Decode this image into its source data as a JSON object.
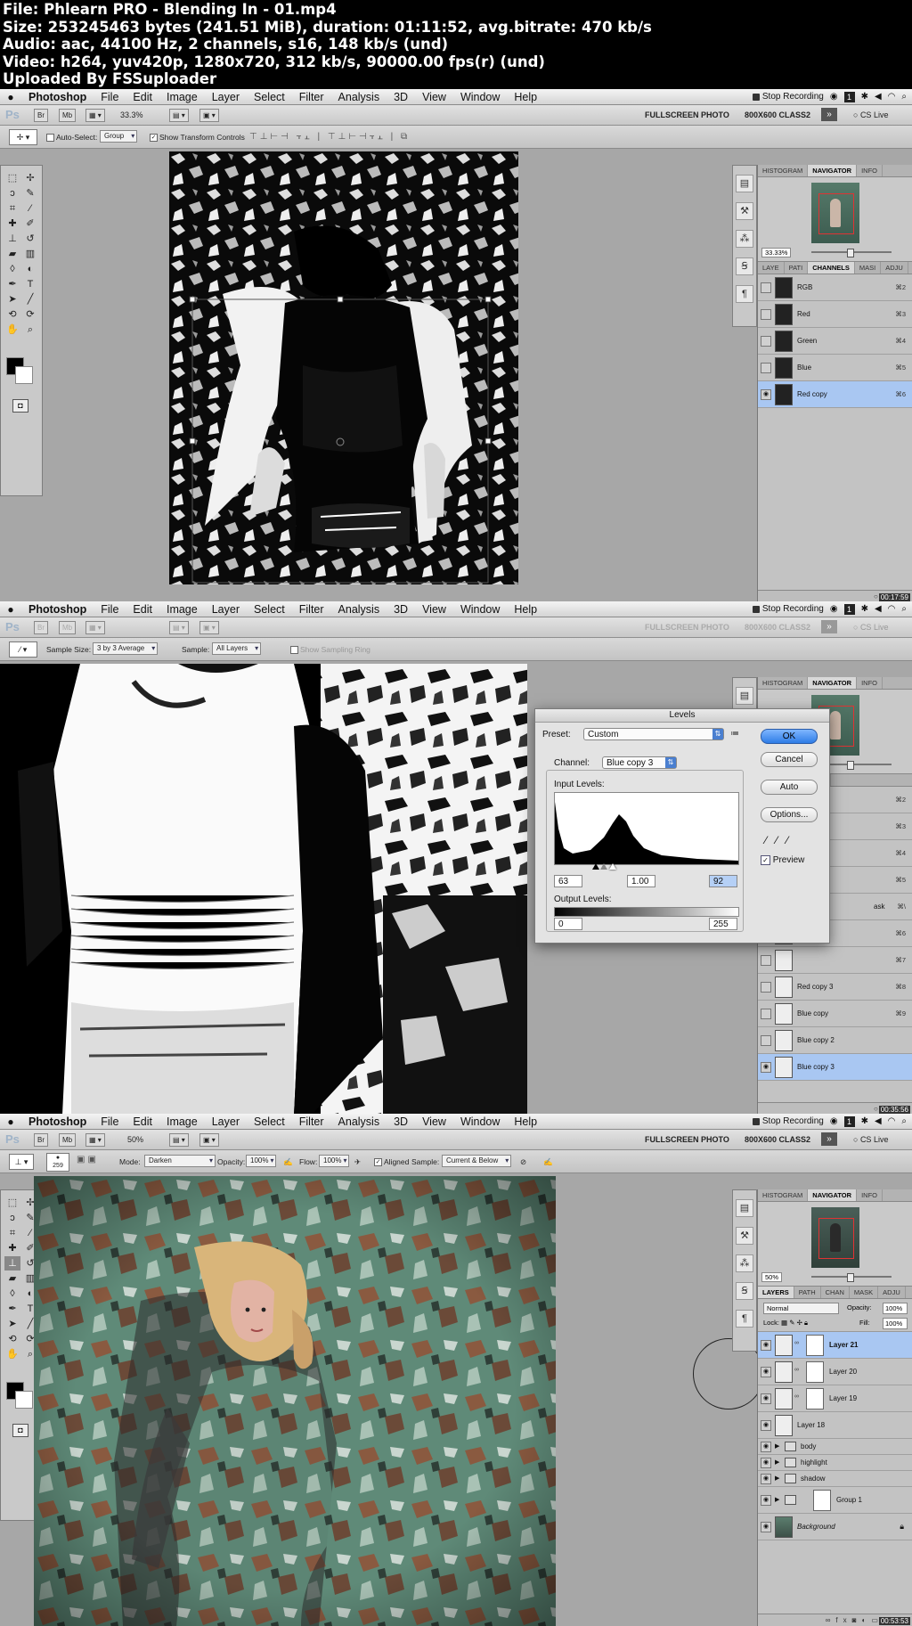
{
  "file_info": {
    "line1": "File: Phlearn PRO - Blending In - 01.mp4",
    "line2": "Size: 253245463 bytes (241.51 MiB), duration: 01:11:52, avg.bitrate: 470 kb/s",
    "line3": "Audio: aac, 44100 Hz, 2 channels, s16, 148 kb/s (und)",
    "line4": "Video: h264, yuv420p, 1280x720, 312 kb/s, 90000.00 fps(r) (und)",
    "line5": "Uploaded By FSSuploader"
  },
  "menu": {
    "app": "Photoshop",
    "items": [
      "File",
      "Edit",
      "Image",
      "Layer",
      "Select",
      "Filter",
      "Analysis",
      "3D",
      "View",
      "Window",
      "Help"
    ],
    "stop_recording": "Stop Recording",
    "badge": "1"
  },
  "appbar": {
    "ps": "Ps",
    "workspace1": "FULLSCREEN PHOTO",
    "workspace2": "800X600 CLASS2",
    "chevron": "»",
    "cs_live": "CS Live"
  },
  "frame1": {
    "zoom": "33.3%",
    "options": {
      "auto_select": "Auto-Select:",
      "group": "Group",
      "show_transform": "Show Transform Controls"
    },
    "panel_tabs_top": [
      "HISTOGRAM",
      "NAVIGATOR",
      "INFO"
    ],
    "nav_zoom": "33.33%",
    "panel_tabs_bottom": [
      "LAYE",
      "PATI",
      "CHANNELS",
      "MASI",
      "ADJU"
    ],
    "channels": [
      {
        "name": "RGB",
        "short": "⌘2"
      },
      {
        "name": "Red",
        "short": "⌘3"
      },
      {
        "name": "Green",
        "short": "⌘4"
      },
      {
        "name": "Blue",
        "short": "⌘5"
      },
      {
        "name": "Red copy",
        "short": "⌘6"
      }
    ],
    "timestamp": "00:17:59"
  },
  "frame2": {
    "options": {
      "sample_size_label": "Sample Size:",
      "sample_size": "3 by 3 Average",
      "sample_label": "Sample:",
      "sample": "All Layers",
      "ring": "Show Sampling Ring"
    },
    "channel_shortcuts": [
      "⌘2",
      "⌘3",
      "⌘4",
      "⌘5",
      "⌘\\",
      "⌘6",
      "⌘7"
    ],
    "mask_partial": "ask",
    "channels": [
      {
        "name": "Red copy 3",
        "short": "⌘8"
      },
      {
        "name": "Blue copy",
        "short": "⌘9"
      },
      {
        "name": "Blue copy 2",
        "short": ""
      },
      {
        "name": "Blue copy 3",
        "short": ""
      }
    ],
    "levels": {
      "title": "Levels",
      "preset_label": "Preset:",
      "preset": "Custom",
      "channel_label": "Channel:",
      "channel": "Blue copy 3",
      "input_label": "Input Levels:",
      "input_black": "63",
      "input_gamma": "1.00",
      "input_white": "92",
      "output_label": "Output Levels:",
      "output_black": "0",
      "output_white": "255",
      "ok": "OK",
      "cancel": "Cancel",
      "auto": "Auto",
      "options": "Options...",
      "preview": "Preview"
    },
    "timestamp": "00:35:56"
  },
  "frame3": {
    "zoom": "50%",
    "options": {
      "brush_size": "259",
      "mode_label": "Mode:",
      "mode": "Darken",
      "opacity_label": "Opacity:",
      "opacity": "100%",
      "flow_label": "Flow:",
      "flow": "100%",
      "aligned": "Aligned",
      "sample_label": "Sample:",
      "sample": "Current & Below"
    },
    "nav_zoom": "50%",
    "panel_tabs_bottom": [
      "LAYERS",
      "PATH",
      "CHAN",
      "MASK",
      "ADJU"
    ],
    "blend_mode": "Normal",
    "opacity_label": "Opacity:",
    "opacity": "100%",
    "lock_label": "Lock:",
    "fill_label": "Fill:",
    "fill": "100%",
    "layers": [
      {
        "name": "Layer 21"
      },
      {
        "name": "Layer 20"
      },
      {
        "name": "Layer 19"
      },
      {
        "name": "Layer 18"
      }
    ],
    "groups": [
      "body",
      "highlight",
      "shadow"
    ],
    "group1": "Group 1",
    "background": "Background",
    "timestamp": "00:53:53"
  }
}
